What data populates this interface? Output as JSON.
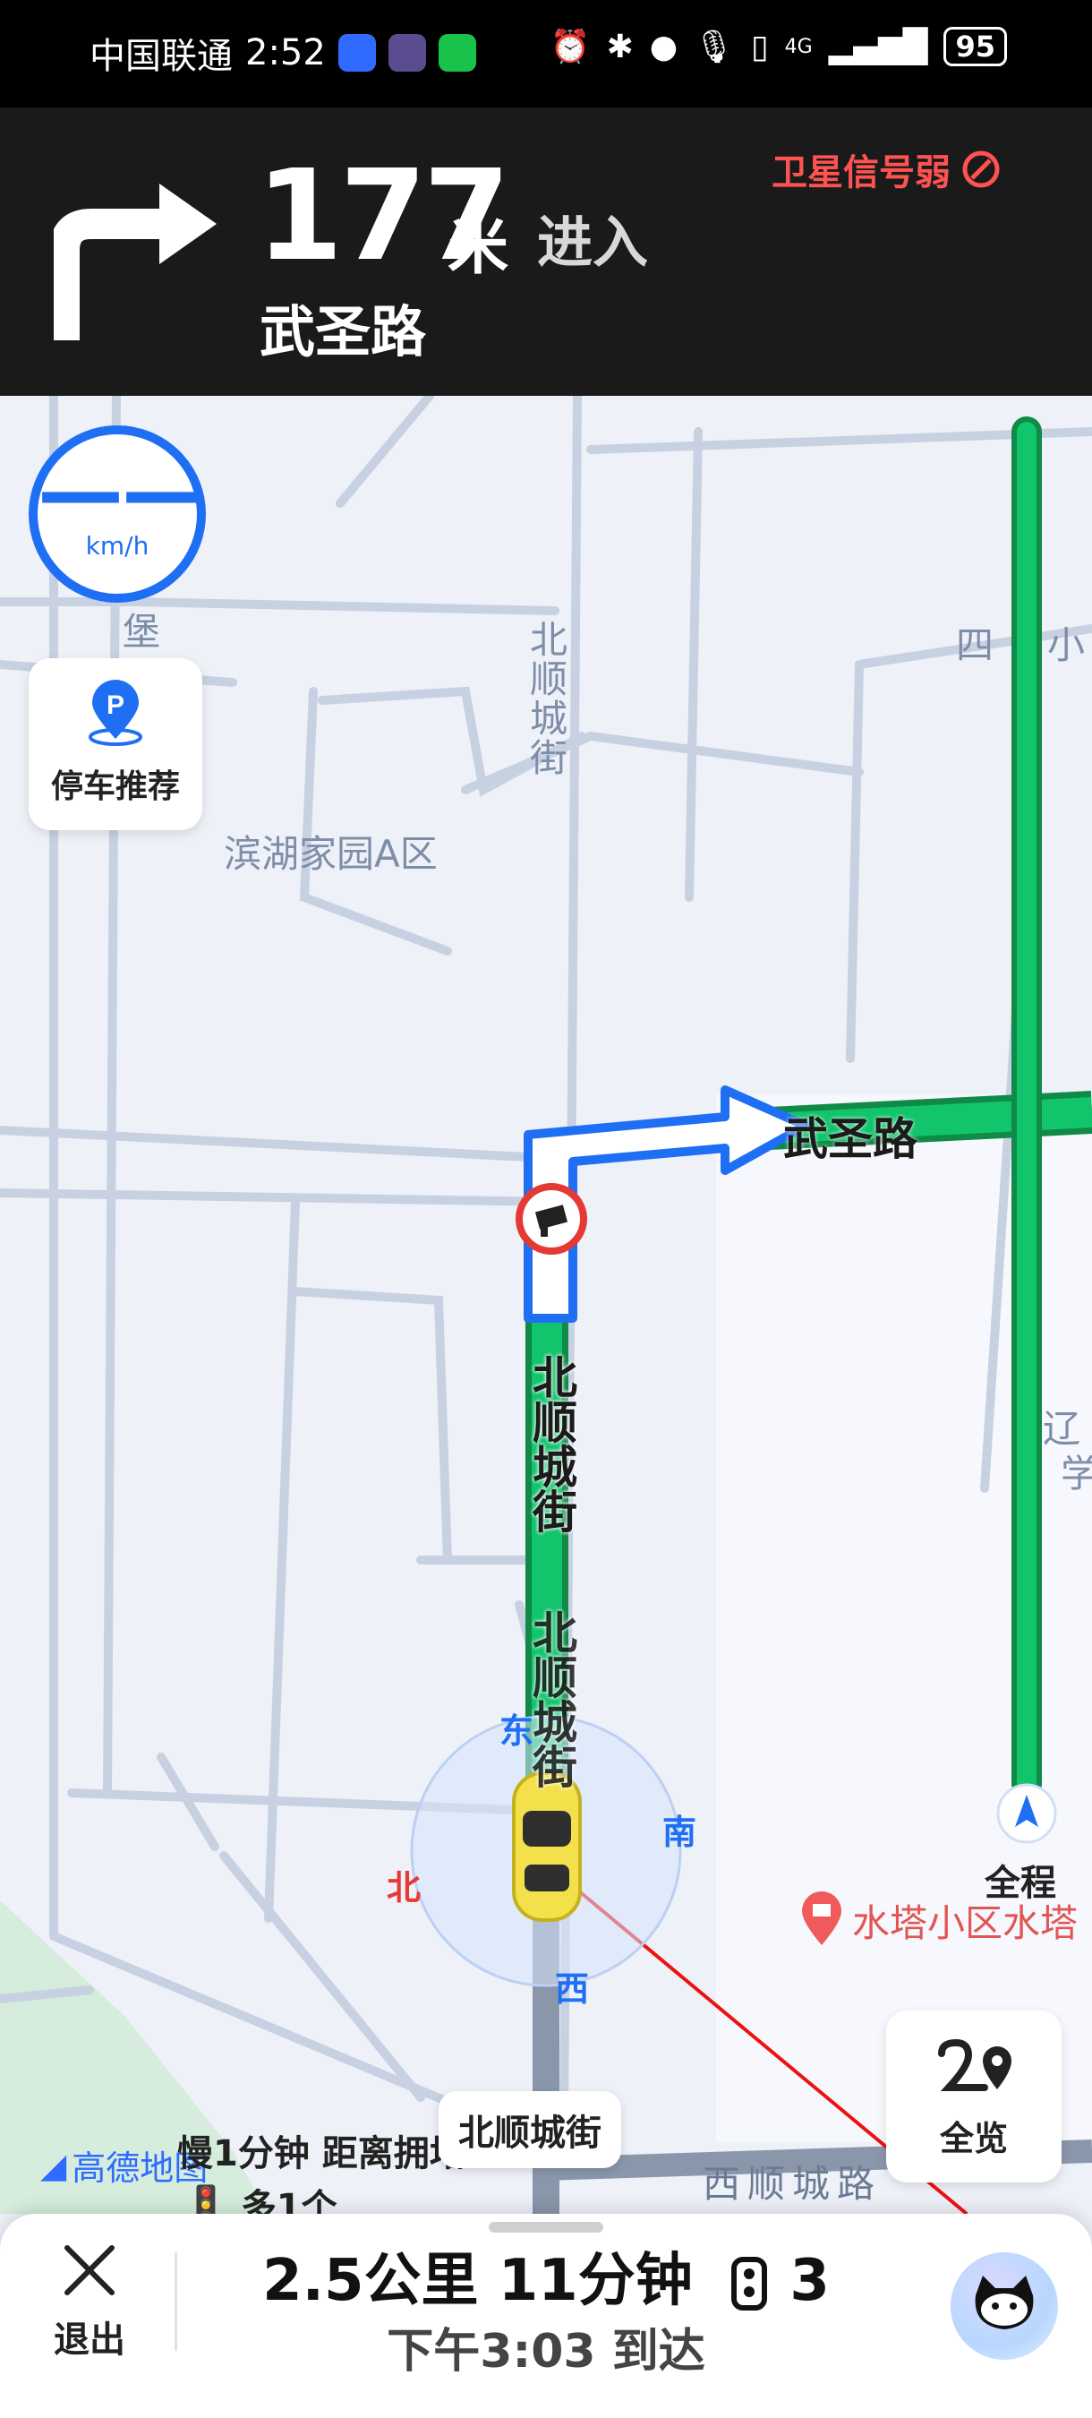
{
  "status_bar": {
    "carrier": "中国联通",
    "time": "2:52",
    "network": "4G",
    "battery": "95"
  },
  "nav_banner": {
    "distance_value": "177",
    "distance_unit": "米",
    "action": "进入",
    "road_name": "武圣路",
    "gps_warning": "卫星信号弱"
  },
  "speed_widget": {
    "value": "——",
    "unit": "km/h"
  },
  "parking_button": {
    "label": "停车推荐"
  },
  "map": {
    "labels": {
      "community": "滨湖家园A区",
      "street_top": "北顺城街",
      "si_label": "四",
      "xiao_label": "小",
      "bao_label": "堡",
      "route_next_road": "武圣路",
      "route_current_road_1": "北顺城街",
      "route_current_road_2": "北顺城街",
      "poi_water_tower": "水塔小区水塔",
      "bottom_road": "西顺城路",
      "right_edge_1": "辽",
      "right_edge_2": "学",
      "full_route_label": "全程"
    },
    "compass": {
      "east": "东",
      "south": "南",
      "north": "北",
      "west": "西"
    },
    "current_road_tag": "北顺城街",
    "overview_button": "全览",
    "logo_text": "高德地图",
    "traffic_light_text": "慢1分钟 距离拥堵",
    "traffic_light_count": "多1个"
  },
  "bottom_panel": {
    "exit_label": "退出",
    "trip_summary": "2.5公里  11分钟",
    "traffic_lights": "3",
    "eta": "下午3:03 到达"
  },
  "colors": {
    "route_green": "#12c46b",
    "route_blue": "#1f6ff5",
    "warning_red": "#ff5252",
    "banner_bg": "#1a1a1a"
  }
}
